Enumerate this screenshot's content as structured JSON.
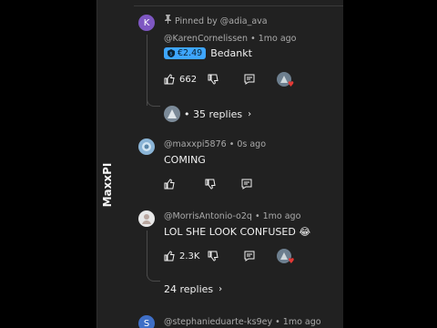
{
  "watermark": "MaxxPI",
  "comments": [
    {
      "avatar_letter": "K",
      "avatar_color": "#7e57c2",
      "pinned_label": "Pinned by @adia_ava",
      "author": "@KarenCornelissen",
      "time": "1mo ago",
      "badge": "€2.49",
      "text": "Bedankt",
      "likes": "662",
      "replies": "35 replies"
    },
    {
      "author": "@maxxpi5876",
      "time": "0s ago",
      "text": "COMING"
    },
    {
      "author": "@MorrisAntonio-o2q",
      "time": "1mo ago",
      "text": "LOL SHE LOOK CONFUSED 😂",
      "likes": "2.3K",
      "replies": "24 replies"
    },
    {
      "avatar_letter": "S",
      "avatar_color": "#3f6fc7",
      "author": "@stephanieduarte-ks9ey",
      "time": "1mo ago"
    }
  ]
}
